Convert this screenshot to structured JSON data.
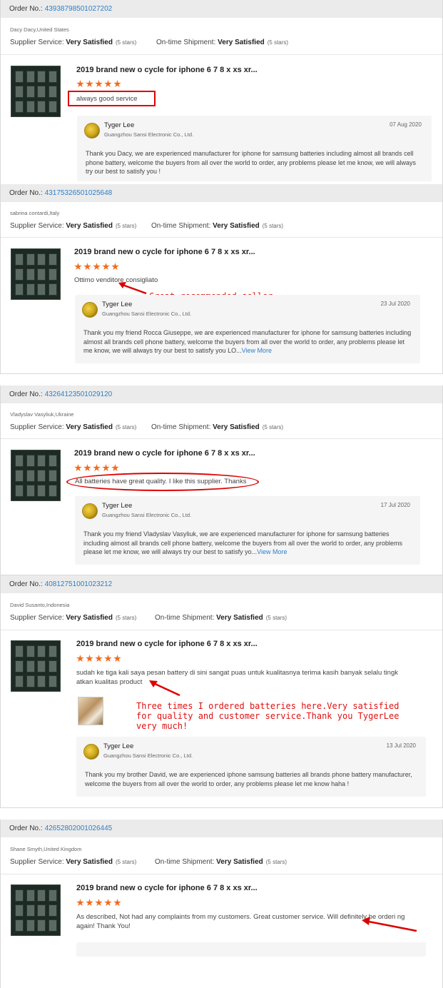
{
  "labels": {
    "order_prefix": "Order No.:",
    "supplier_service": "Supplier Service:",
    "ontime_shipment": "On-time Shipment:",
    "view_more": "View More"
  },
  "reviews": [
    {
      "order_no": "43938798501027202",
      "buyer": "Dacy Dacy,United States",
      "supplier_rating": "Very Satisfied",
      "supplier_stars": "(5 stars)",
      "shipment_rating": "Very Satisfied",
      "shipment_stars": "(5 stars)",
      "product_title": "2019 brand new o cycle for iphone 6 7 8 x xs xr...",
      "stars": 5,
      "feedback": "always good service",
      "reply_name": "Tyger Lee",
      "reply_company": "Guangzhou Sansi Electronic Co., Ltd.",
      "reply_date": "07 Aug 2020",
      "reply_text": "Thank you Dacy, we are experienced manufacturer for iphone for samsung batteries including almost all brands cell phone battery, welcome the buyers from all over the world to order, any problems please let me know, we will always try our best to satisfy you !"
    },
    {
      "order_no": "43175326501025648",
      "buyer": "sabrina contardi,Italy",
      "supplier_rating": "Very Satisfied",
      "supplier_stars": "(5 stars)",
      "shipment_rating": "Very Satisfied",
      "shipment_stars": "(5 stars)",
      "product_title": "2019 brand new o cycle for iphone 6 7 8 x xs xr...",
      "stars": 5,
      "feedback": "Ottimo venditore consigliato",
      "annotation": "Great recommended seller",
      "reply_name": "Tyger Lee",
      "reply_company": "Guangzhou Sansi Electronic Co., Ltd.",
      "reply_date": "23 Jul 2020",
      "reply_text": "Thank you my friend Rocca Giuseppe, we are experienced manufacturer for iphone for samsung batteries including almost all brands cell phone battery, welcome the buyers from all over the world to order, any problems please let me know, we will always try our best to satisfy you LO..."
    },
    {
      "order_no": "43264123501029120",
      "buyer": "Vladyslav Vasyliuk,Ukraine",
      "supplier_rating": "Very Satisfied",
      "supplier_stars": "(5 stars)",
      "shipment_rating": "Very Satisfied",
      "shipment_stars": "(5 stars)",
      "product_title": "2019 brand new o cycle for iphone 6 7 8 x xs xr...",
      "stars": 5,
      "feedback": "All batteries have great quality. I like this supplier. Thanks",
      "reply_name": "Tyger Lee",
      "reply_company": "Guangzhou Sansi Electronic Co., Ltd.",
      "reply_date": "17 Jul 2020",
      "reply_text": "Thank you my friend Vladyslav Vasyliuk, we are experienced manufacturer for iphone for samsung batteries including almost all brands cell phone battery, welcome the buyers from all over the world to order, any problems please let me know, we will always try our best to satisfy yo..."
    },
    {
      "order_no": "40812751001023212",
      "buyer": "David Susanto,Indonesia",
      "supplier_rating": "Very Satisfied",
      "supplier_stars": "(5 stars)",
      "shipment_rating": "Very Satisfied",
      "shipment_stars": "(5 stars)",
      "product_title": "2019 brand new o cycle for iphone 6 7 8 x xs xr...",
      "stars": 5,
      "feedback": "sudah ke tiga kali saya pesan battery di sini sangat puas untuk kualitasnya terima kasih banyak selalu tingk atkan kualitas product",
      "annotation_lines": [
        "Three times I ordered batteries here.Very satisfied",
        " for quality and customer service.Thank you TygerLee",
        " very much!"
      ],
      "reply_name": "Tyger Lee",
      "reply_company": "Guangzhou Sansi Electronic Co., Ltd.",
      "reply_date": "13 Jul 2020",
      "reply_text": "Thank you my brother David, we are experienced iphone samsung batteries all brands phone battery manufacturer, welcome the buyers from all over the world to order, any problems please let me know haha !"
    },
    {
      "order_no": "42652802001026445",
      "buyer": "Shane Smyth,United Kingdom",
      "supplier_rating": "Very Satisfied",
      "supplier_stars": "(5 stars)",
      "shipment_rating": "Very Satisfied",
      "shipment_stars": "(5 stars)",
      "product_title": "2019 brand new o cycle for iphone 6 7 8 x xs xr...",
      "stars": 5,
      "feedback": "As described, Not had any complaints from my customers. Great customer service. Will definitely be orderi ng again! Thank You!"
    }
  ],
  "colors": {
    "accent_link": "#2d7fc7",
    "star": "#f26b1d",
    "annotation": "#e01010",
    "order_bar": "#ebebeb"
  }
}
